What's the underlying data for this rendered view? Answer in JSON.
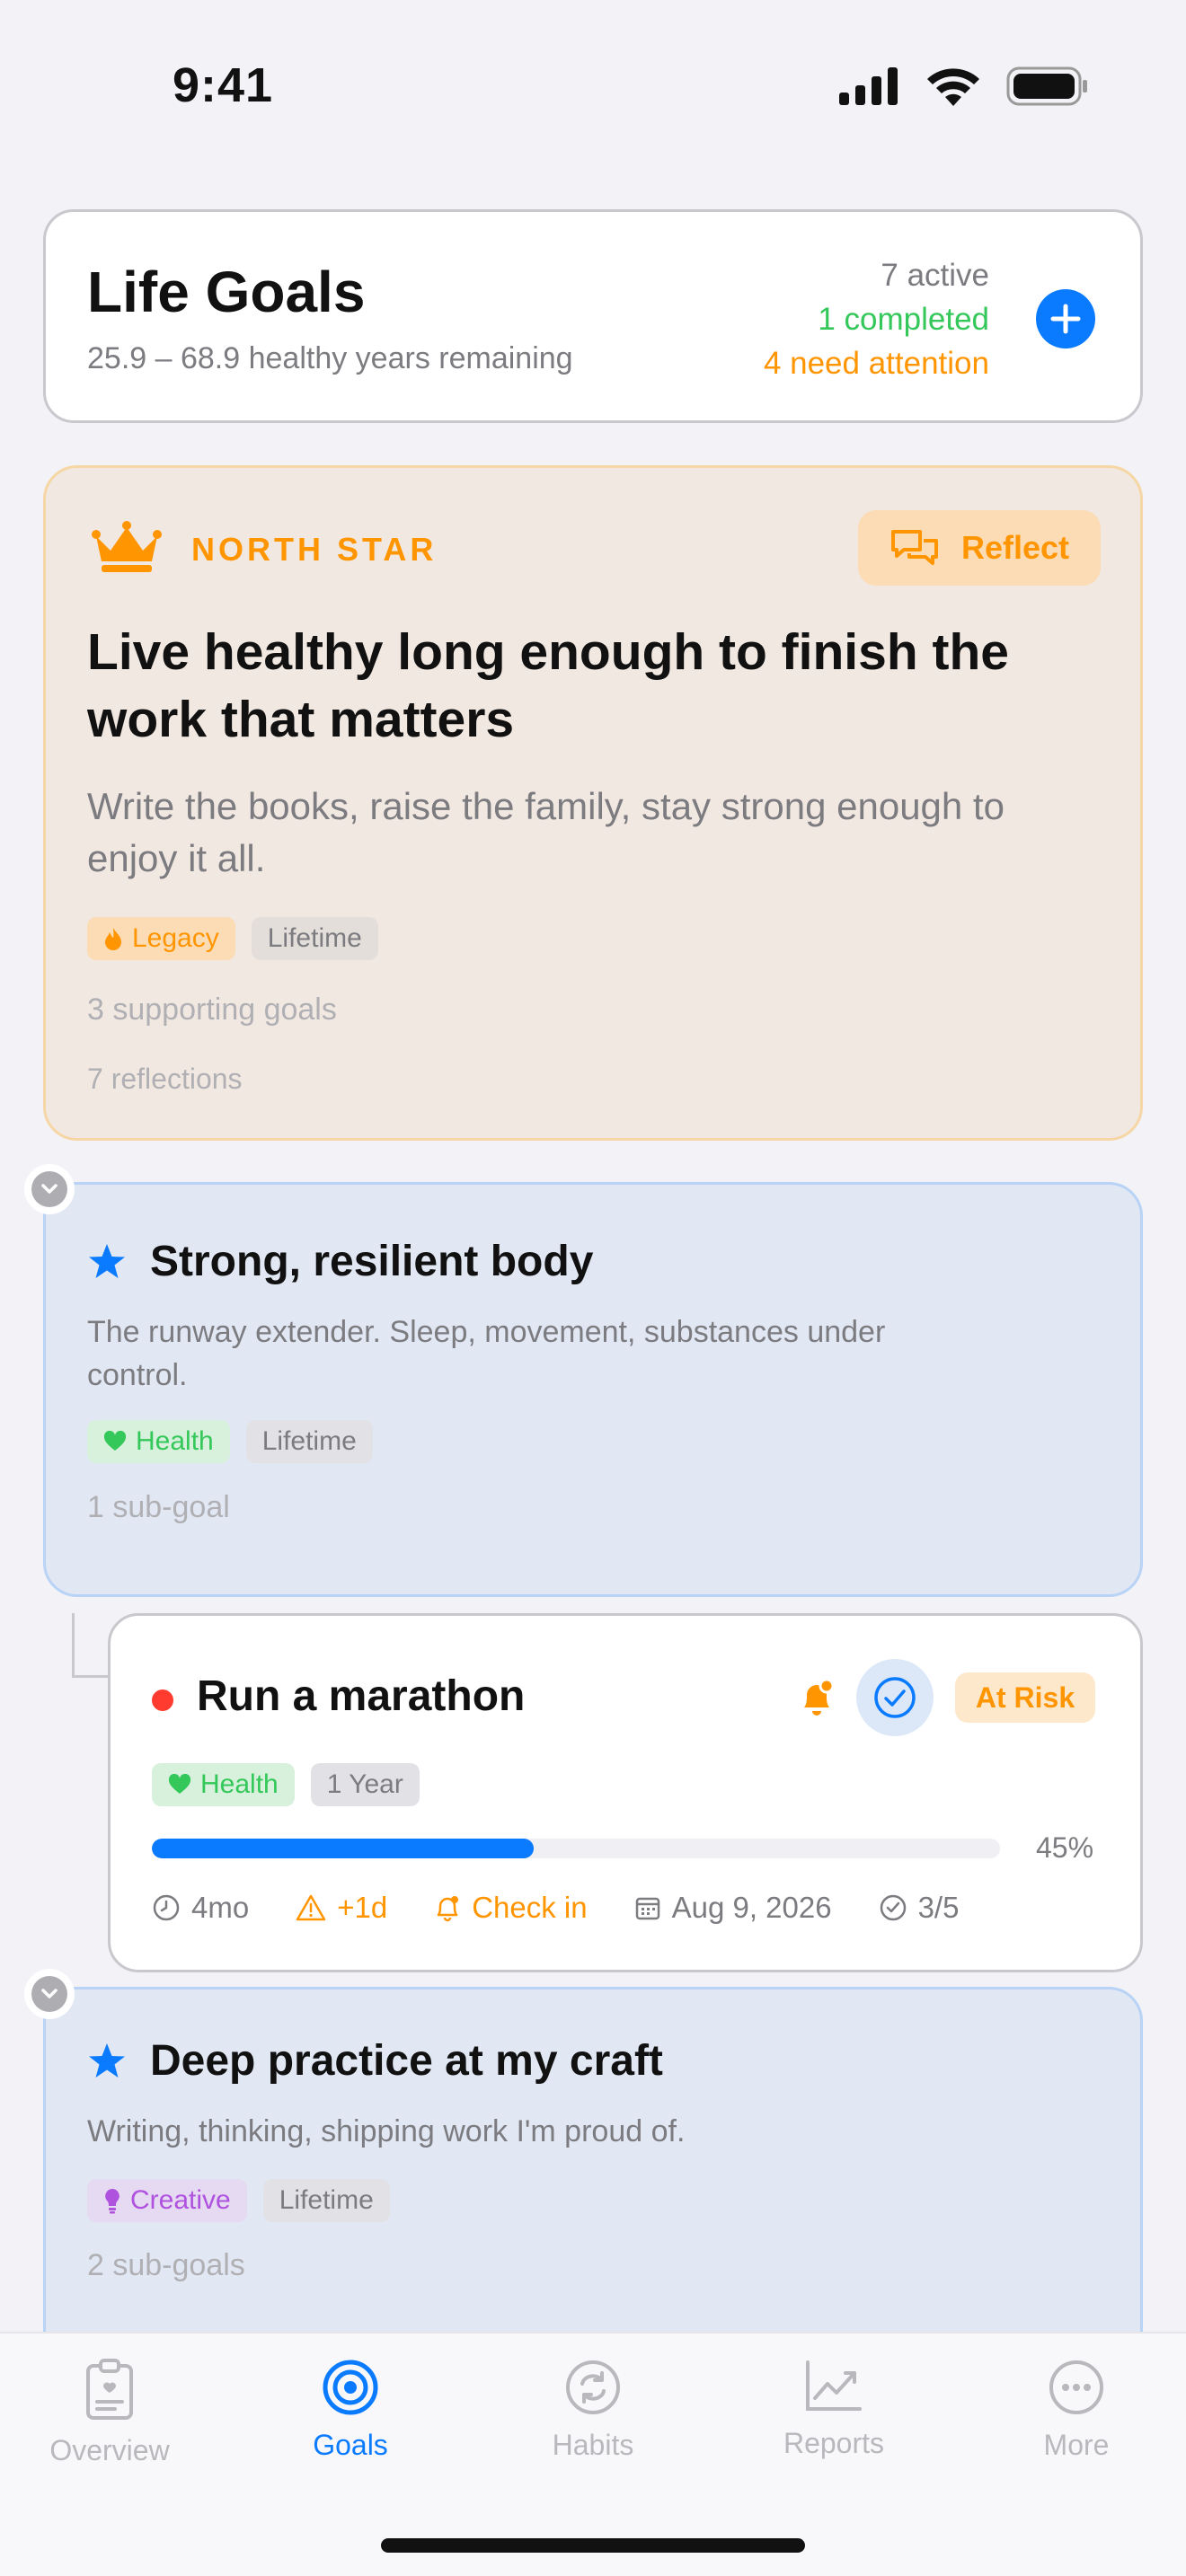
{
  "status_bar": {
    "time": "9:41"
  },
  "summary": {
    "title": "Life Goals",
    "subtitle": "25.9 – 68.9 healthy years remaining",
    "active": "7 active",
    "completed": "1 completed",
    "attention": "4 need attention"
  },
  "north_star": {
    "label": "NORTH STAR",
    "reflect_label": "Reflect",
    "title": "Live healthy long enough to finish the work that matters",
    "description": "Write the books, raise the family, stay strong enough to enjoy it all.",
    "tags": [
      "Legacy",
      "Lifetime"
    ],
    "supporting": "3 supporting goals",
    "reflections": "7 reflections"
  },
  "goals": [
    {
      "title": "Strong, resilient body",
      "description": "The runway extender. Sleep, movement, substances under control.",
      "tags": [
        "Health",
        "Lifetime"
      ],
      "subcount": "1 sub-goal"
    },
    {
      "title": "Deep practice at my craft",
      "description": "Writing, thinking, shipping work I'm proud of.",
      "tags": [
        "Creative",
        "Lifetime"
      ],
      "subcount": "2 sub-goals"
    }
  ],
  "subgoal": {
    "title": "Run a marathon",
    "status": "At Risk",
    "tags": [
      "Health",
      "1 Year"
    ],
    "progress": 0.45,
    "progress_label": "45%",
    "meta": {
      "duration": "4mo",
      "overdue": "+1d",
      "checkin": "Check in",
      "date": "Aug 9, 2026",
      "tasks": "3/5"
    }
  },
  "tabs": [
    {
      "label": "Overview",
      "icon": "clipboard-icon"
    },
    {
      "label": "Goals",
      "icon": "target-icon"
    },
    {
      "label": "Habits",
      "icon": "repeat-icon"
    },
    {
      "label": "Reports",
      "icon": "chart-icon"
    },
    {
      "label": "More",
      "icon": "ellipsis-icon"
    }
  ],
  "colors": {
    "accent": "#0a7bff",
    "orange": "#ff9500",
    "green": "#34c759",
    "red": "#ff3b30",
    "purple": "#af52de"
  }
}
